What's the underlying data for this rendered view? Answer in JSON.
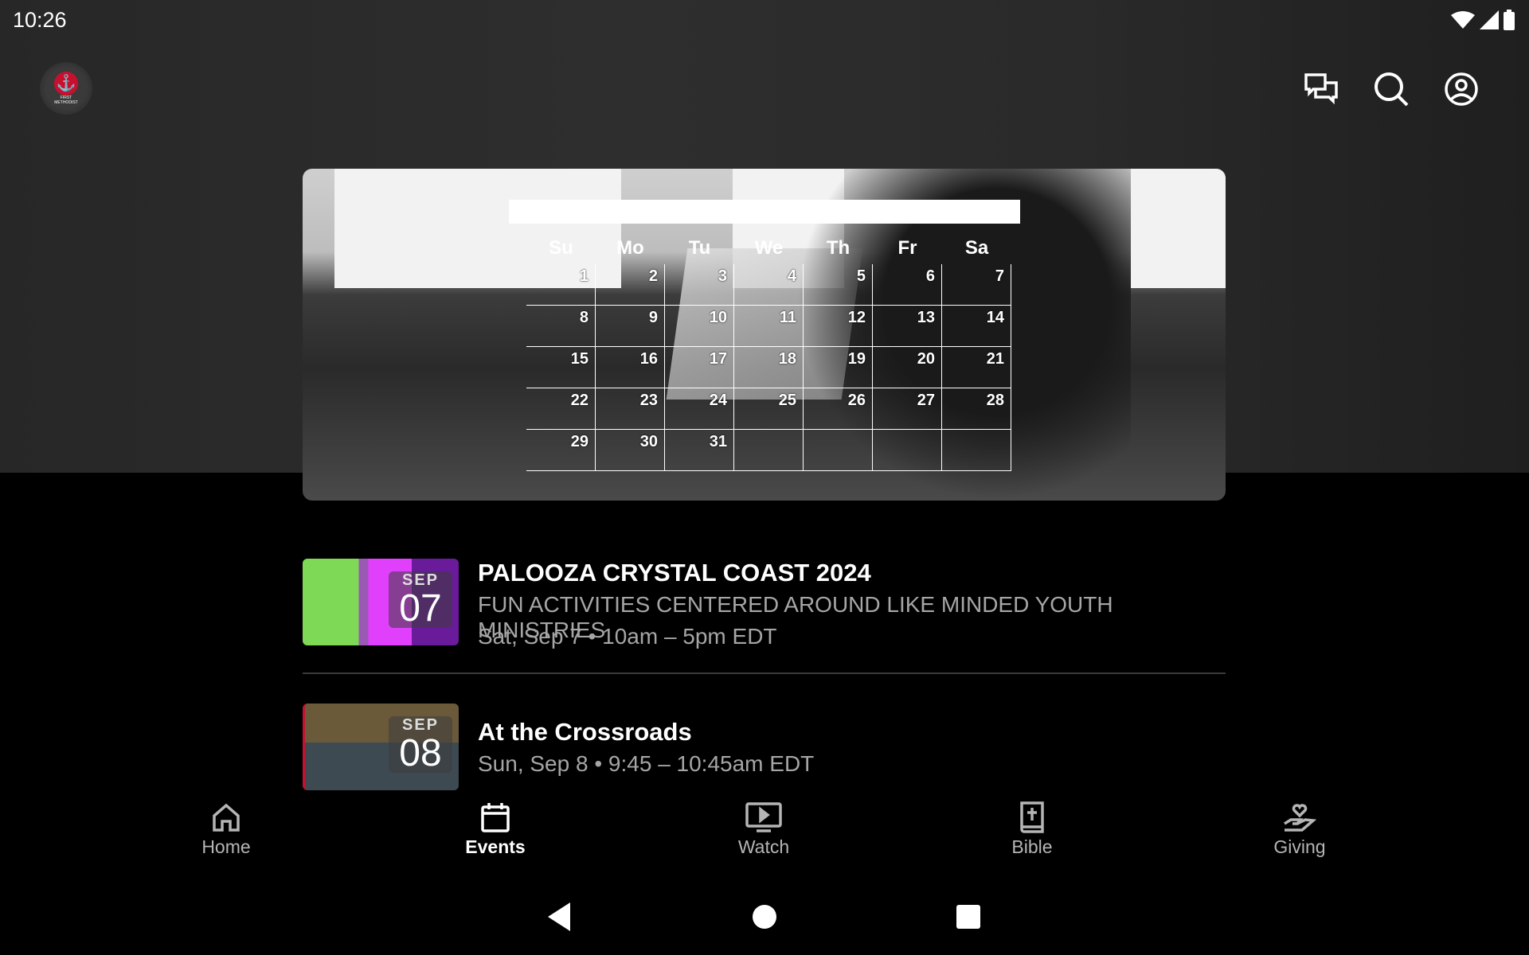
{
  "status_bar": {
    "time": "10:26"
  },
  "app_bar": {
    "logo_text": "FIRST METHODIST",
    "icons": [
      "chat-icon",
      "search-icon",
      "account-icon"
    ]
  },
  "banner": {
    "calendar": {
      "days": [
        "Su",
        "Mo",
        "Tu",
        "We",
        "Th",
        "Fr",
        "Sa"
      ],
      "weeks": [
        [
          "1",
          "2",
          "3",
          "4",
          "5",
          "6",
          "7"
        ],
        [
          "8",
          "9",
          "10",
          "11",
          "12",
          "13",
          "14"
        ],
        [
          "15",
          "16",
          "17",
          "18",
          "19",
          "20",
          "21"
        ],
        [
          "22",
          "23",
          "24",
          "25",
          "26",
          "27",
          "28"
        ],
        [
          "29",
          "30",
          "31",
          "",
          "",
          "",
          ""
        ]
      ]
    }
  },
  "events": [
    {
      "title": "PALOOZA CRYSTAL COAST 2024",
      "description": "FUN ACTIVITIES CENTERED AROUND LIKE MINDED YOUTH MINISTRIES",
      "datetime": "Sat, Sep 7 • 10am – 5pm EDT",
      "badge_month": "SEP",
      "badge_day": "07"
    },
    {
      "title": "At the Crossroads",
      "datetime": "Sun, Sep 8 • 9:45 – 10:45am EDT",
      "badge_month": "SEP",
      "badge_day": "08"
    }
  ],
  "bottom_nav": {
    "active": "Events",
    "items": [
      {
        "label": "Home",
        "icon": "home-icon"
      },
      {
        "label": "Events",
        "icon": "calendar-icon"
      },
      {
        "label": "Watch",
        "icon": "tv-icon"
      },
      {
        "label": "Bible",
        "icon": "bible-icon"
      },
      {
        "label": "Giving",
        "icon": "giving-icon"
      }
    ]
  },
  "colors": {
    "background": "#000000",
    "header": "#2b2b2b",
    "logo_red": "#c8102e",
    "muted_text": "#a6a6a6"
  }
}
